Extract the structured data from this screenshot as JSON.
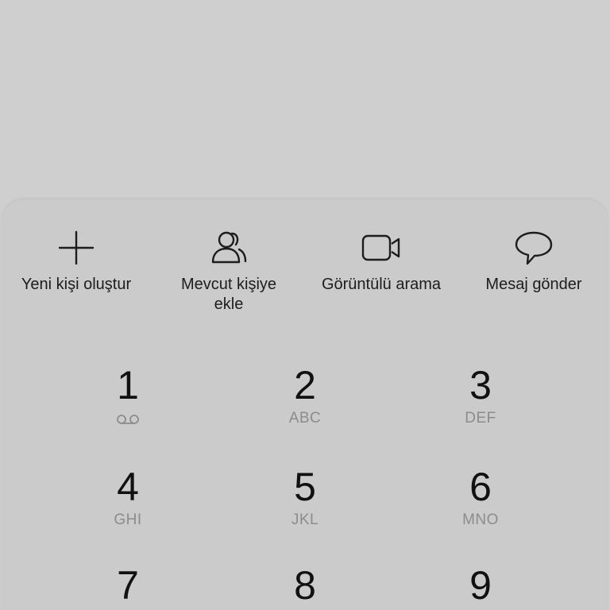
{
  "actions": [
    {
      "label": "Yeni kişi oluştur",
      "icon": "plus-icon"
    },
    {
      "label": "Mevcut kişiye\nekle",
      "icon": "contacts-icon"
    },
    {
      "label": "Görüntülü arama",
      "icon": "video-camera-icon"
    },
    {
      "label": "Mesaj gönder",
      "icon": "message-bubble-icon"
    }
  ],
  "keypad": {
    "keys": [
      {
        "digit": "1",
        "letters": "",
        "icon": "voicemail-icon"
      },
      {
        "digit": "2",
        "letters": "ABC"
      },
      {
        "digit": "3",
        "letters": "DEF"
      },
      {
        "digit": "4",
        "letters": "GHI"
      },
      {
        "digit": "5",
        "letters": "JKL"
      },
      {
        "digit": "6",
        "letters": "MNO"
      },
      {
        "digit": "7",
        "letters": ""
      },
      {
        "digit": "8",
        "letters": ""
      },
      {
        "digit": "9",
        "letters": ""
      }
    ]
  }
}
